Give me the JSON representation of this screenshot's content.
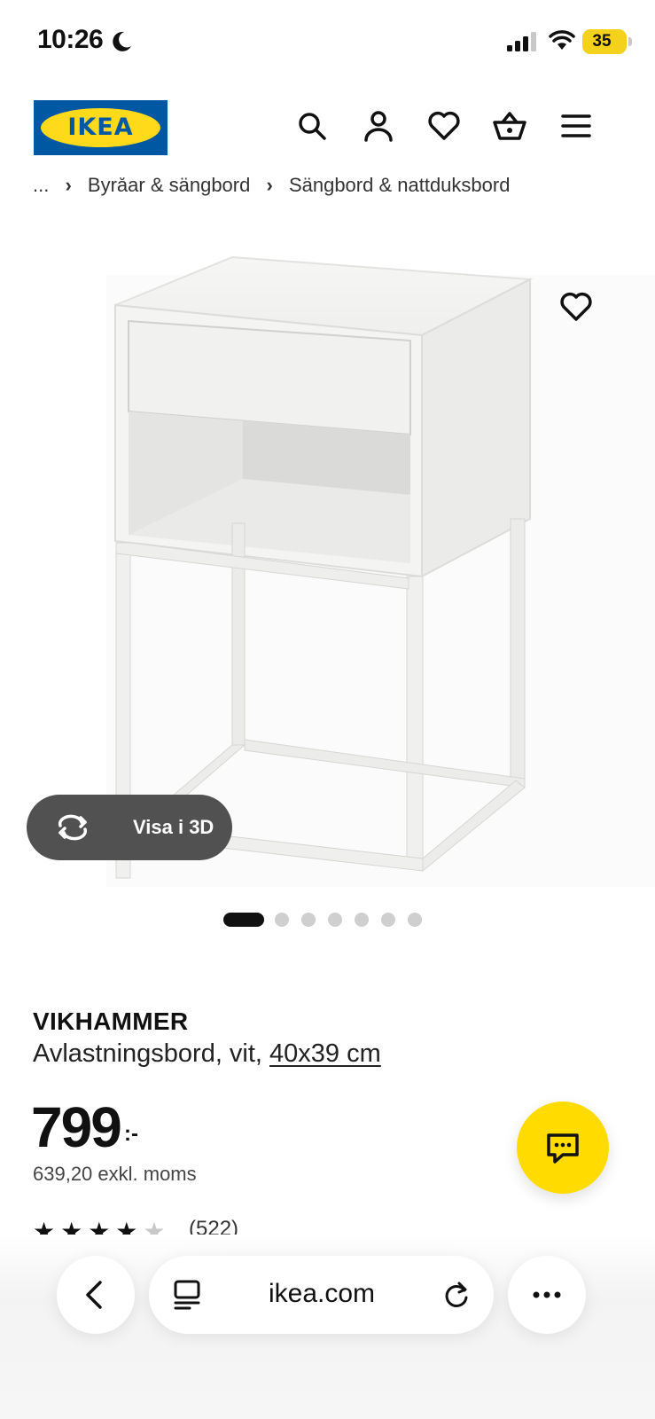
{
  "status_bar": {
    "time": "10:26",
    "battery": "35",
    "moon_icon": "moon-icon",
    "signal_icon": "cellular-signal-icon",
    "wifi_icon": "wifi-icon",
    "battery_color": "#f4d21b"
  },
  "header": {
    "logo": "IKEA",
    "icons": [
      "search-icon",
      "account-icon",
      "heart-icon",
      "shopping-basket-icon",
      "menu-icon"
    ],
    "logo_blue": "#0058a3",
    "logo_yellow": "#ffda1a"
  },
  "breadcrumb": {
    "items": [
      "...",
      "Byråar & sängbord",
      "Sängbord & nattduksbord"
    ]
  },
  "gallery": {
    "favorite_icon": "heart-icon",
    "view_3d_label": "Visa i 3D",
    "view_3d_icon": "rotate-3d-icon",
    "image_count": 7,
    "active_index": 0
  },
  "product": {
    "name": "VIKHAMMER",
    "description": "Avlastningsbord, vit, ",
    "size": "40x39 cm",
    "price": "799",
    "price_suffix": ":-",
    "price_excl_vat": "639,20 exkl. moms",
    "rating": 4.5,
    "review_count": "(522)"
  },
  "chat": {
    "icon": "chat-bubble-icon",
    "color": "#ffdb00"
  },
  "browser_bar": {
    "url": "ikea.com",
    "back_icon": "chevron-left-icon",
    "tab_icon": "page-menu-icon",
    "reload_icon": "reload-icon",
    "more_icon": "more-dots-icon"
  }
}
